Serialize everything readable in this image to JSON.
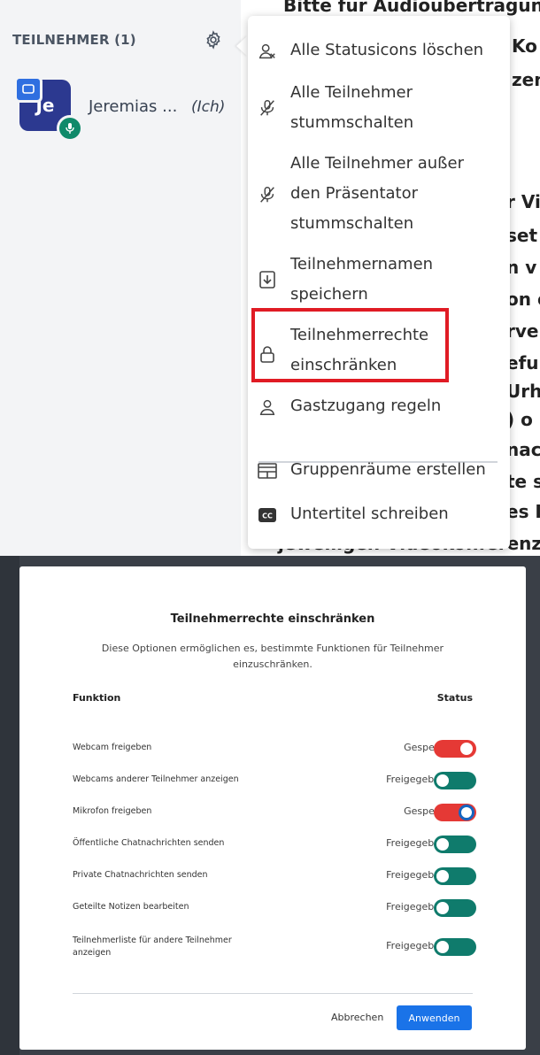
{
  "sidebar": {
    "title": "TEILNEHMER (1)",
    "user": {
      "initials": "Je",
      "name": "Jeremias ...",
      "me": "(Ich)"
    }
  },
  "doc_fragments": [
    "Bitte für Audioübertragunge",
    "Ko",
    "zen",
    "r Vi",
    "set",
    "n v",
    "on c",
    "rve",
    "eful",
    "Urh",
    ") o",
    "nac",
    "te s",
    "es I",
    "jeweiligen Videokonferenz z"
  ],
  "menu": {
    "items": [
      {
        "icon": "user-clear-icon",
        "label": "Alle Statusicons löschen"
      },
      {
        "icon": "mic-muted-icon",
        "label": "Alle Teilnehmer stummschalten",
        "lines": [
          "Alle Teilnehmer",
          "stummschalten"
        ]
      },
      {
        "icon": "mic-muted-icon",
        "label": "Alle Teilnehmer außer den Präsentator stummschalten",
        "lines": [
          "Alle Teilnehmer außer",
          "den Präsentator",
          "stummschalten"
        ]
      },
      {
        "icon": "download-icon",
        "label": "Teilnehmernamen speichern",
        "lines": [
          "Teilnehmernamen",
          "speichern"
        ]
      },
      {
        "icon": "lock-icon",
        "label": "Teilnehmerrechte einschränken",
        "lines": [
          "Teilnehmerrechte",
          "einschränken"
        ]
      },
      {
        "icon": "user-icon",
        "label": "Gastzugang regeln"
      },
      {
        "icon": "breakout-rooms-icon",
        "label": "Gruppenräume erstellen"
      },
      {
        "icon": "closed-captions-icon",
        "label": "Untertitel schreiben"
      }
    ]
  },
  "modal": {
    "title": "Teilnehmerrechte einschränken",
    "description": "Diese Optionen ermöglichen es, bestimmte Funktionen für Teilnehmer einzuschränken.",
    "col_function": "Funktion",
    "col_status": "Status",
    "rows": [
      {
        "label": "Webcam freigeben",
        "status": "Gesperrt",
        "locked": true
      },
      {
        "label": "Webcams anderer Teilnehmer anzeigen",
        "status": "Freigegeben",
        "locked": false
      },
      {
        "label": "Mikrofon freigeben",
        "status": "Gesperrt",
        "locked": true
      },
      {
        "label": "Öffentliche Chatnachrichten senden",
        "status": "Freigegeben",
        "locked": false
      },
      {
        "label": "Private Chatnachrichten senden",
        "status": "Freigegeben",
        "locked": false
      },
      {
        "label": "Geteilte Notizen bearbeiten",
        "status": "Freigegeben",
        "locked": false
      },
      {
        "label": "Teilnehmerliste für andere Teilnehmer anzeigen",
        "status": "Freigegeben",
        "locked": false
      }
    ],
    "cancel_label": "Abbrechen",
    "apply_label": "Anwenden"
  },
  "colors": {
    "locked": "#e53935",
    "unlocked": "#0f7b6c",
    "primary": "#1a73e8",
    "highlight": "#e01b24"
  }
}
